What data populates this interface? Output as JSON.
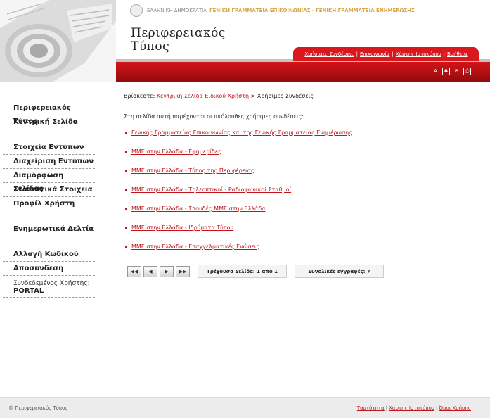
{
  "header": {
    "ministry_gov": "ΕΛΛΗΝΙΚΗ ΔΗΜΟΚΡΑΤΙΑ",
    "ministry_sec": "ΓΕΝΙΚΗ ΓΡΑΜΜΑΤΕΙΑ ΕΠΙΚΟΙΝΩΝΙΑΣ - ΓΕΝΙΚΗ ΓΡΑΜΜΑΤΕΙΑ ΕΝΗΜΕΡΩΣΗΣ",
    "site_title_line1": "Περιφερειακός",
    "site_title_line2": "Τύπος",
    "top_nav": [
      "Χρήσιμες Συνδέσεις",
      "Επικοινωνία",
      "Χάρτης Ιστοτόπου",
      "Βοήθεια"
    ],
    "tool_icons": [
      "font-size-decrease-icon",
      "font-size-increase-icon",
      "email-icon",
      "print-icon"
    ],
    "accent_color": "#d8181c"
  },
  "sidebar": {
    "items": [
      "Περιφερειακός Τύπος",
      "Κεντρική Σελίδα",
      "Στοιχεία Εντύπων",
      "Διαχείριση Εντύπων",
      "Διαμόρφωση Σελίδας",
      "Στατιστικά Στοιχεία",
      "Προφίλ Χρήστη",
      "Ενημερωτικά Δελτία",
      "Αλλαγή Κωδικού",
      "Αποσύνδεση"
    ],
    "user_label": "Συνδεδεμένος Χρήστης:",
    "user_value": "PORTAL"
  },
  "main": {
    "breadcrumb_prefix": "Βρίσκεστε:",
    "breadcrumb_link": "Κεντρική Σελίδα Ειδικού Χρήστη",
    "breadcrumb_current": "> Χρήσιμες Συνδέσεις",
    "intro": "Στη σελίδα αυτή παρέχονται οι ακόλουθες χρήσιμες συνδέσεις:",
    "links": [
      "Γενικής Γραμματείας Επικοινωνίας και της Γενικής Γραμματείας Ενημέρωσης",
      "ΜΜΕ στην Ελλάδα - Εφημερίδες",
      "ΜΜΕ στην Ελλάδα - Τύπος της Περιφέρειας",
      "ΜΜΕ στην Ελλάδα - Τηλεοπτικοί - Ραδιοφωνικοί Σταθμοί",
      "ΜΜΕ στην Ελλάδα - Σπουδές ΜΜΕ στην Ελλάδα",
      "ΜΜΕ στην Ελλάδα - Ιδρύματα Τύπου",
      "ΜΜΕ στην Ελλάδα - Επαγγελματικές Ενώσεις"
    ]
  },
  "pager": {
    "buttons": [
      "first-page",
      "previous-page",
      "next-page",
      "last-page"
    ],
    "current_page": "Τρέχουσα Σελίδα: 1 από 1",
    "total_records": "Συνολικές εγγραφές: 7"
  },
  "footer": {
    "copyright": "© Περιφερειακός Τύπος",
    "links": [
      "Ταυτότητα",
      "Χάρτης Ιστοτόπου",
      "Όροι Χρήσης"
    ]
  }
}
